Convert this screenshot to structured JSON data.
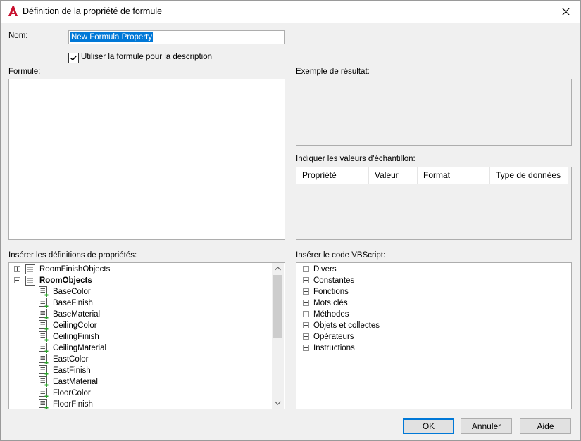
{
  "window": {
    "title": "Définition de la propriété de formule",
    "accent": "#0078d7",
    "app_icon_color": "#c8102e"
  },
  "name_field": {
    "label": "Nom:",
    "value": "New Formula Property"
  },
  "checkbox": {
    "label": "Utiliser la formule pour la description",
    "checked": true
  },
  "formula": {
    "label": "Formule:",
    "value": ""
  },
  "result_example": {
    "label": "Exemple de résultat:"
  },
  "sample_values": {
    "label": "Indiquer les valeurs d'échantillon:",
    "columns": [
      "Propriété",
      "Valeur",
      "Format",
      "Type de données"
    ]
  },
  "property_defs": {
    "label": "Insérer les définitions de propriétés:",
    "items": [
      {
        "label": "RoomFinishObjects",
        "level": 0,
        "expander": "plus",
        "bold": false
      },
      {
        "label": "RoomObjects",
        "level": 0,
        "expander": "minus",
        "bold": true
      },
      {
        "label": "BaseColor",
        "level": 1
      },
      {
        "label": "BaseFinish",
        "level": 1
      },
      {
        "label": "BaseMaterial",
        "level": 1
      },
      {
        "label": "CeilingColor",
        "level": 1
      },
      {
        "label": "CeilingFinish",
        "level": 1
      },
      {
        "label": "CeilingMaterial",
        "level": 1
      },
      {
        "label": "EastColor",
        "level": 1
      },
      {
        "label": "EastFinish",
        "level": 1
      },
      {
        "label": "EastMaterial",
        "level": 1
      },
      {
        "label": "FloorColor",
        "level": 1
      },
      {
        "label": "FloorFinish",
        "level": 1
      }
    ]
  },
  "vbscript": {
    "label": "Insérer le code VBScript:",
    "items": [
      "Divers",
      "Constantes",
      "Fonctions",
      "Mots clés",
      "Méthodes",
      "Objets et collectes",
      "Opérateurs",
      "Instructions"
    ]
  },
  "buttons": {
    "ok": "OK",
    "cancel": "Annuler",
    "help": "Aide"
  }
}
